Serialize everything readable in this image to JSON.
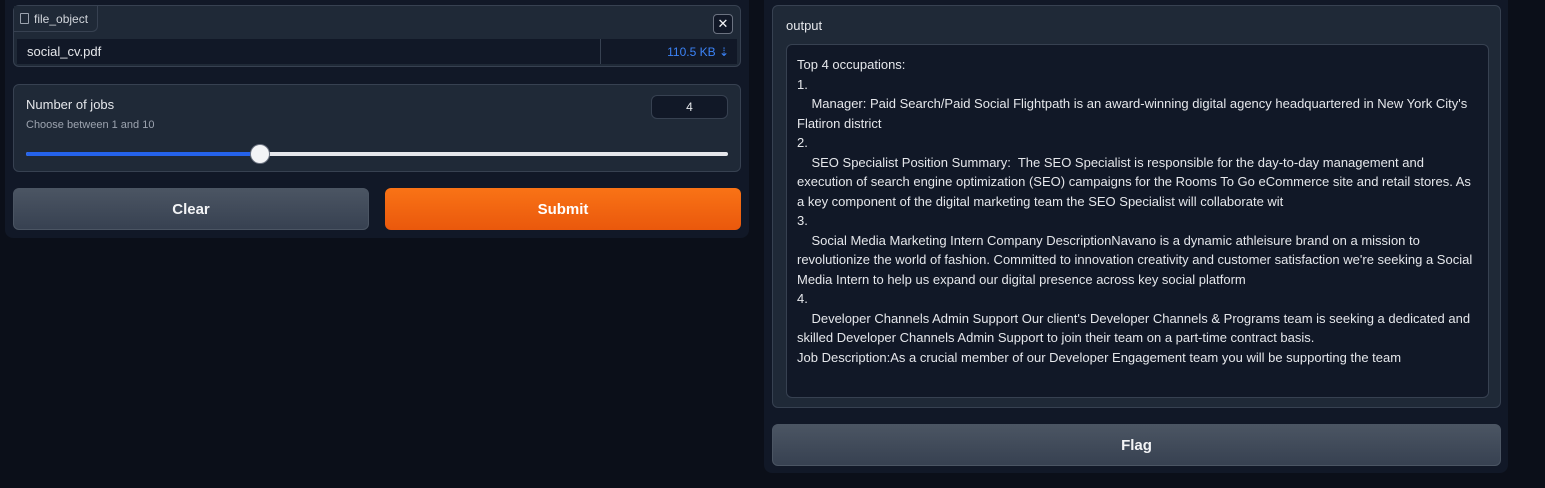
{
  "input": {
    "file_label": "file_object",
    "file_name": "social_cv.pdf",
    "file_size": "110.5 KB ⇣",
    "close_glyph": "✕"
  },
  "slider": {
    "title": "Number of jobs",
    "info": "Choose between 1 and 10",
    "value": "4",
    "min": 1,
    "max": 10
  },
  "buttons": {
    "clear": "Clear",
    "submit": "Submit",
    "flag": "Flag"
  },
  "output": {
    "label": "output",
    "text": "Top 4 occupations:\n1.\n    Manager: Paid Search/Paid Social Flightpath is an award-winning digital agency headquartered in New York City's Flatiron district\n2.\n    SEO Specialist Position Summary:  The SEO Specialist is responsible for the day-to-day management and execution of search engine optimization (SEO) campaigns for the Rooms To Go eCommerce site and retail stores. As a key component of the digital marketing team the SEO Specialist will collaborate wit\n3.\n    Social Media Marketing Intern Company DescriptionNavano is a dynamic athleisure brand on a mission to revolutionize the world of fashion. Committed to innovation creativity and customer satisfaction we're seeking a Social Media Intern to help us expand our digital presence across key social platform\n4.\n    Developer Channels Admin Support Our client's Developer Channels & Programs team is seeking a dedicated and skilled Developer Channels Admin Support to join their team on a part-time contract basis.\nJob Description:As a crucial member of our Developer Engagement team you will be supporting the team"
  },
  "colors": {
    "accent": "#f97316",
    "slider_fill": "#2563eb",
    "background": "#0b0f19"
  }
}
